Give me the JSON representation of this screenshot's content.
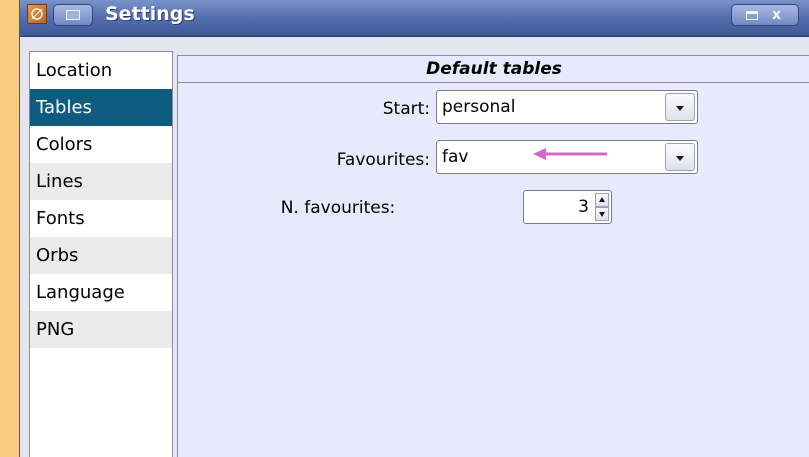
{
  "window": {
    "title": "Settings",
    "icons": {
      "app": "app-icon",
      "menu": "window-menu-icon",
      "maximize": "maximize-icon",
      "close": "close-icon"
    },
    "close_glyph": "x"
  },
  "sidebar": {
    "items": [
      {
        "label": "Location",
        "selected": false
      },
      {
        "label": "Tables",
        "selected": true
      },
      {
        "label": "Colors",
        "selected": false
      },
      {
        "label": "Lines",
        "selected": false
      },
      {
        "label": "Fonts",
        "selected": false
      },
      {
        "label": "Orbs",
        "selected": false
      },
      {
        "label": "Language",
        "selected": false
      },
      {
        "label": "PNG",
        "selected": false
      }
    ]
  },
  "panel": {
    "title": "Default tables",
    "start": {
      "label": "Start:",
      "value": "personal"
    },
    "favourites": {
      "label": "Favourites:",
      "value": "fav"
    },
    "n_favourites": {
      "label": "N. favourites:",
      "value": "3"
    }
  },
  "colors": {
    "selection": "#0d5b7e",
    "annotation_arrow": "#d467c9",
    "panel_background": "#e8e9fc",
    "titlebar": "#5671b0"
  }
}
